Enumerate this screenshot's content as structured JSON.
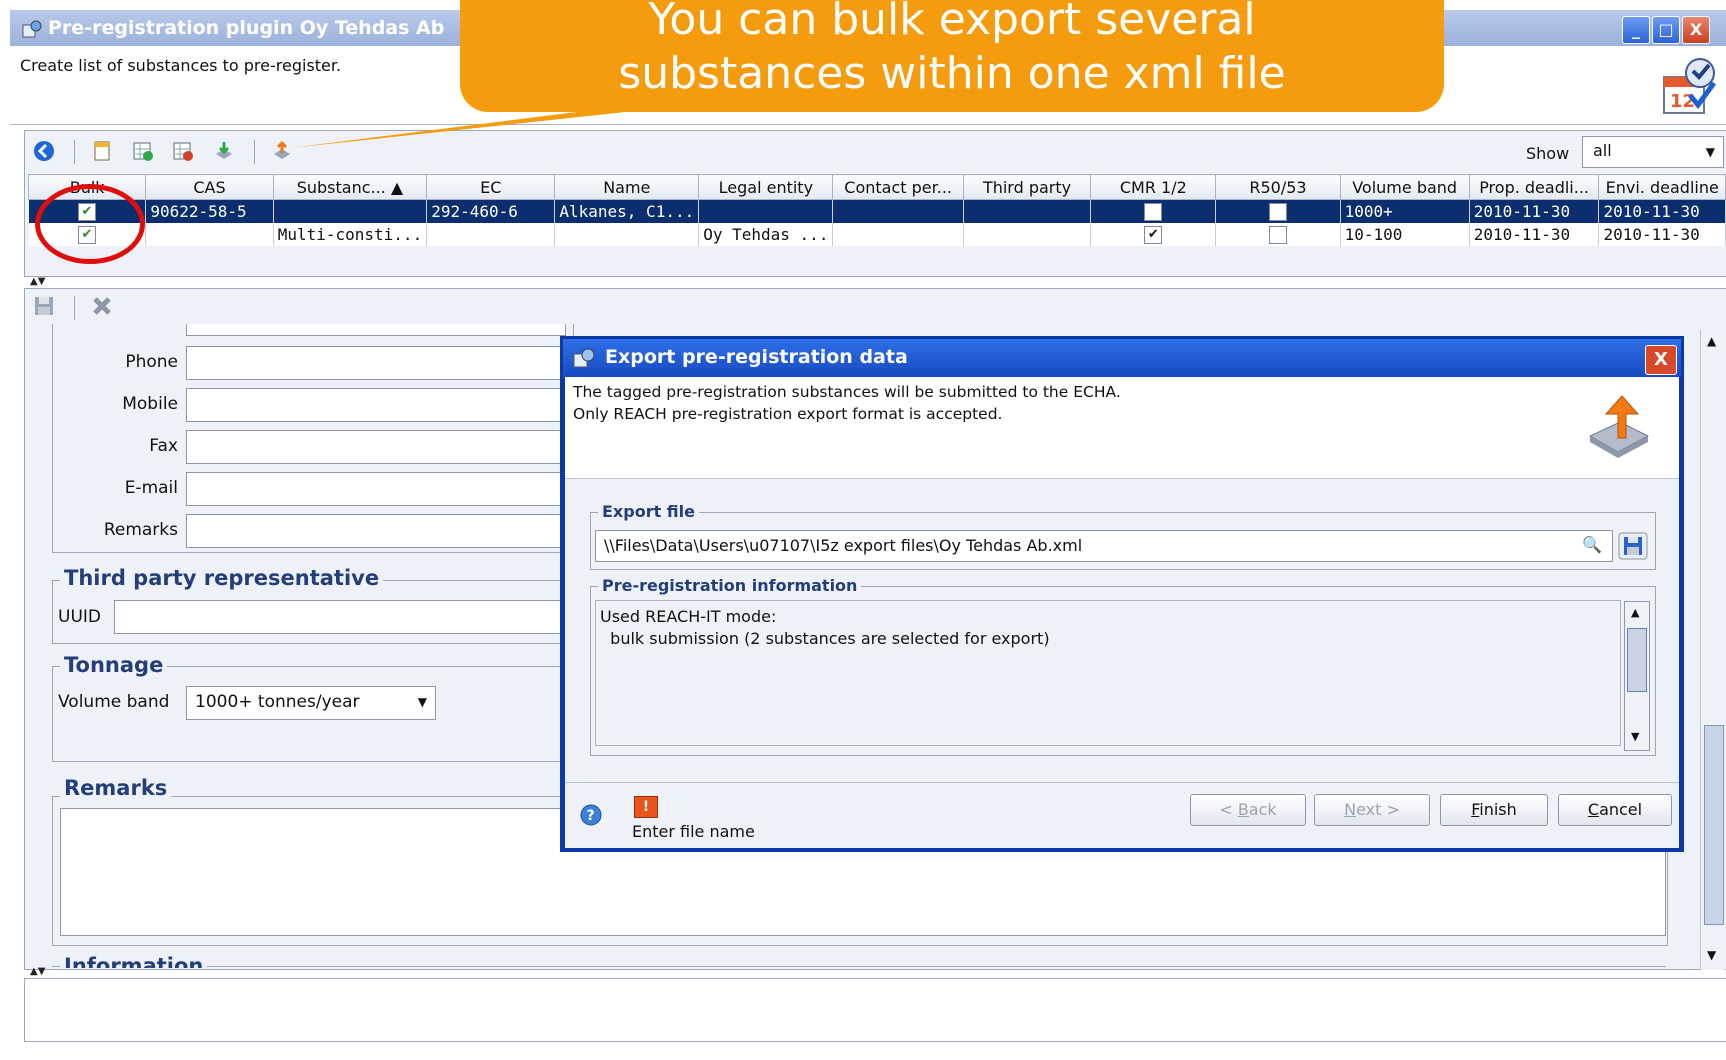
{
  "window": {
    "title": "Pre-registration plugin Oy Tehdas Ab",
    "subtitle": "Create list of substances to pre-register.",
    "minimize": "_",
    "maximize": "□",
    "close": "X"
  },
  "callout": {
    "line1": "You can bulk export several",
    "line2": "substances within one xml file",
    "color": "#f59b0e"
  },
  "toolbar": {
    "icons": [
      "back-icon",
      "new-icon",
      "add-icon",
      "add-all-icon",
      "import-icon",
      "export-icon"
    ],
    "show_label": "Show",
    "show_value": "all"
  },
  "grid": {
    "columns": [
      "Bulk",
      "CAS",
      "Substanc... ▲",
      "EC",
      "Name",
      "Legal entity",
      "Contact per...",
      "Third party",
      "CMR 1/2",
      "R50/53",
      "Volume band",
      "Prop. deadli...",
      "Envi. deadline"
    ],
    "rows": [
      {
        "bulk": true,
        "cas": "90622-58-5",
        "substance": "",
        "ec": "292-460-6",
        "name": "Alkanes, C1...",
        "legal": "",
        "contact": "",
        "third": "",
        "cmr": false,
        "r50": false,
        "volume": "1000+",
        "prop": "2010-11-30",
        "envi": "2010-11-30",
        "selected": true
      },
      {
        "bulk": true,
        "cas": "",
        "substance": "Multi-consti...",
        "ec": "",
        "name": "",
        "legal": "Oy Tehdas ...",
        "contact": "",
        "third": "",
        "cmr": true,
        "r50": false,
        "volume": "10-100",
        "prop": "2010-11-30",
        "envi": "2010-11-30",
        "selected": false
      }
    ]
  },
  "form": {
    "phone_label": "Phone",
    "mobile_label": "Mobile",
    "fax_label": "Fax",
    "email_label": "E-mail",
    "remarks_label": "Remarks",
    "third_party_legend": "Third party representative",
    "uuid_label": "UUID",
    "tonnage_legend": "Tonnage",
    "volume_band_label": "Volume band",
    "volume_band_value": "1000+ tonnes/year",
    "remarks_legend": "Remarks",
    "information_legend": "Information"
  },
  "dialog": {
    "title": "Export pre-registration data",
    "close": "X",
    "line1": "The tagged pre-registration substances will be submitted to the ECHA.",
    "line2": "Only REACH pre-registration export format is accepted.",
    "export_file_legend": "Export file",
    "export_path": "\\\\Files\\Data\\Users\\u07107\\I5z export files\\Oy Tehdas Ab.xml",
    "info_legend": "Pre-registration information",
    "info_line1": "Used REACH-IT mode:",
    "info_line2": "  bulk submission (2 substances are selected for export)",
    "status_badge": "!",
    "status_text": "Enter file name",
    "back_prefix": "< ",
    "back_key": "B",
    "back_rest": "ack",
    "next_key": "N",
    "next_rest": "ext >",
    "finish_key": "F",
    "finish_rest": "inish",
    "cancel_key": "C",
    "cancel_rest": "ancel"
  }
}
